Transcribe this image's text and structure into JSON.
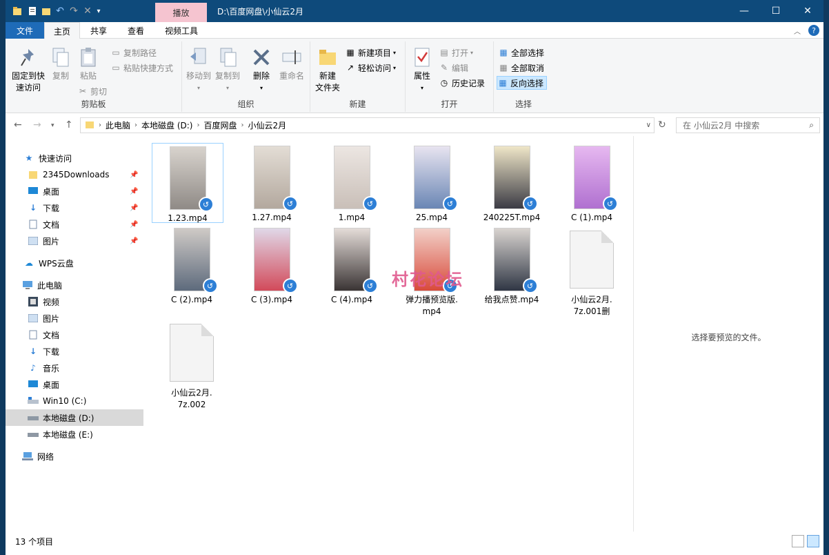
{
  "window": {
    "title": "D:\\百度网盘\\小仙云2月",
    "context_tab": "播放"
  },
  "ribbon_tabs": [
    {
      "label": "文件"
    },
    {
      "label": "主页"
    },
    {
      "label": "共享"
    },
    {
      "label": "查看"
    },
    {
      "label": "视频工具"
    }
  ],
  "ribbon": {
    "clipboard": {
      "group": "剪贴板",
      "pin_quick_1": "固定到快",
      "pin_quick_2": "速访问",
      "copy": "复制",
      "paste": "粘贴",
      "copy_path": "复制路径",
      "paste_shortcut": "粘贴快捷方式",
      "cut": "剪切"
    },
    "organize": {
      "group": "组织",
      "move_to": "移动到",
      "copy_to": "复制到",
      "delete": "删除",
      "rename": "重命名"
    },
    "new": {
      "group": "新建",
      "new_folder_1": "新建",
      "new_folder_2": "文件夹",
      "new_item": "新建项目",
      "easy_access": "轻松访问"
    },
    "open": {
      "group": "打开",
      "properties": "属性",
      "open": "打开",
      "edit": "编辑",
      "history": "历史记录"
    },
    "select": {
      "group": "选择",
      "select_all": "全部选择",
      "select_none": "全部取消",
      "invert": "反向选择"
    }
  },
  "address": {
    "crumbs": [
      "此电脑",
      "本地磁盘 (D:)",
      "百度网盘",
      "小仙云2月"
    ],
    "search_placeholder": "在 小仙云2月 中搜索"
  },
  "nav": {
    "quick_access": "快速访问",
    "quick_items": [
      "2345Downloads",
      "桌面",
      "下载",
      "文档",
      "图片"
    ],
    "wps": "WPS云盘",
    "this_pc": "此电脑",
    "pc_items": [
      "视频",
      "图片",
      "文档",
      "下载",
      "音乐",
      "桌面",
      "Win10 (C:)",
      "本地磁盘 (D:)",
      "本地磁盘 (E:)"
    ],
    "network": "网络"
  },
  "files": [
    {
      "name": "1.23.mp4"
    },
    {
      "name": "1.27.mp4"
    },
    {
      "name": "1.mp4"
    },
    {
      "name": "25.mp4"
    },
    {
      "name": "240225T.mp4"
    },
    {
      "name": "C (1).mp4"
    },
    {
      "name": "C (2).mp4"
    },
    {
      "name": "C (3).mp4"
    },
    {
      "name": "C (4).mp4"
    },
    {
      "name1": "弹力播预览版.",
      "name2": "mp4"
    },
    {
      "name": "给我点赞.mp4"
    },
    {
      "name1": "小仙云2月.",
      "name2": "7z.001删"
    },
    {
      "name1": "小仙云2月.",
      "name2": "7z.002"
    }
  ],
  "watermark": "村花论坛",
  "preview_text": "选择要预览的文件。",
  "status": "13 个项目",
  "colors": {
    "titlebar": "#0e4a7b",
    "file_tab": "#1e6bb8",
    "context_tab": "#f5c4d0",
    "selected_nav": "#d9d9d9"
  }
}
